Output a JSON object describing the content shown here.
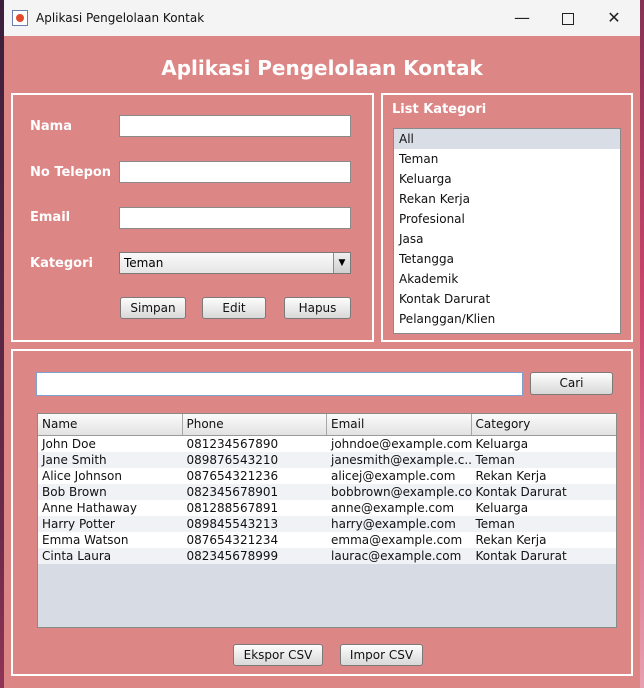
{
  "window": {
    "title": "Aplikasi Pengelolaan Kontak"
  },
  "header": {
    "title": "Aplikasi Pengelolaan Kontak"
  },
  "form": {
    "nama_label": "Nama",
    "nama_value": "",
    "telepon_label": "No Telepon",
    "telepon_value": "",
    "email_label": "Email",
    "email_value": "",
    "kategori_label": "Kategori",
    "kategori_selected": "Teman",
    "simpan_label": "Simpan",
    "edit_label": "Edit",
    "hapus_label": "Hapus"
  },
  "categories": {
    "title": "List Kategori",
    "items": [
      "All",
      "Teman",
      "Keluarga",
      "Rekan Kerja",
      "Profesional",
      "Jasa",
      "Tetangga",
      "Akademik",
      "Kontak Darurat",
      "Pelanggan/Klien"
    ],
    "selected": "All"
  },
  "search": {
    "value": "",
    "button_label": "Cari"
  },
  "table": {
    "columns": [
      "Name",
      "Phone",
      "Email",
      "Category"
    ],
    "rows": [
      [
        "John Doe",
        "081234567890",
        "johndoe@example.com",
        "Keluarga"
      ],
      [
        "Jane Smith",
        "089876543210",
        "janesmith@example.c...",
        "Teman"
      ],
      [
        "Alice Johnson",
        "087654321236",
        "alicej@example.com",
        "Rekan Kerja"
      ],
      [
        "Bob Brown",
        "082345678901",
        "bobbrown@example.co",
        "Kontak Darurat"
      ],
      [
        "Anne Hathaway",
        "081288567891",
        "anne@example.com",
        "Keluarga"
      ],
      [
        "Harry Potter",
        "089845543213",
        "harry@example.com",
        "Teman"
      ],
      [
        "Emma Watson",
        "087654321234",
        "emma@example.com",
        "Rekan Kerja"
      ],
      [
        "Cinta Laura",
        "082345678999",
        "laurac@example.com",
        "Kontak Darurat"
      ]
    ]
  },
  "footer": {
    "ekspor_label": "Ekspor CSV",
    "impor_label": "Impor CSV"
  },
  "colors": {
    "background": "#dc8686",
    "accent": "#ffffff",
    "selected": "#d9dde6"
  }
}
